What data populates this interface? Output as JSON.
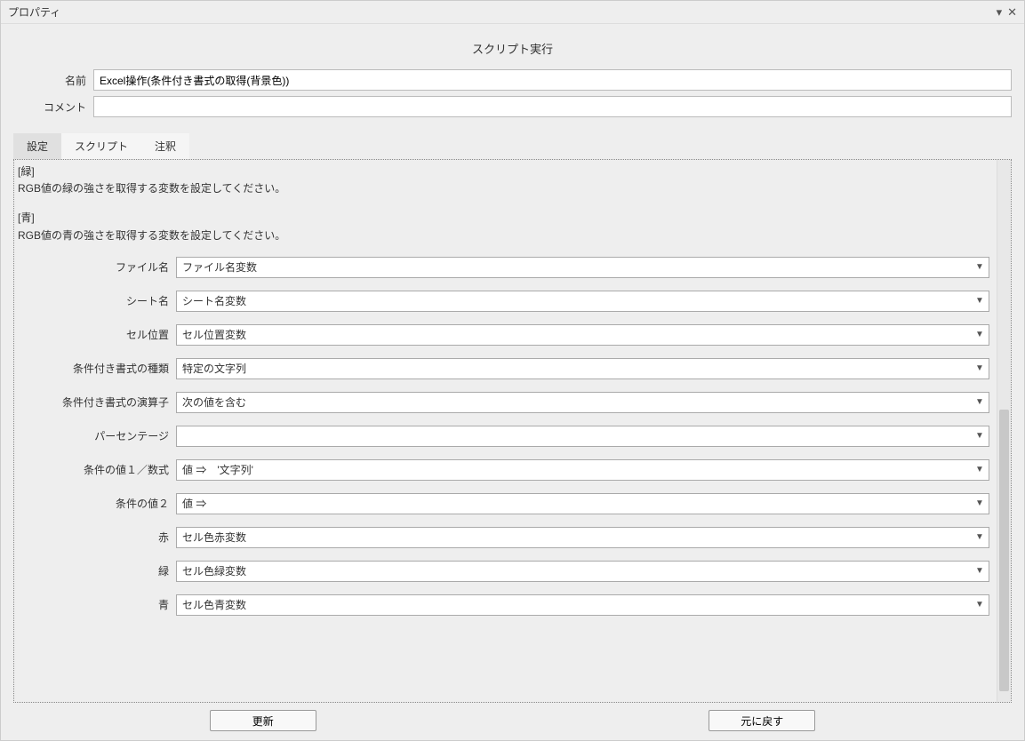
{
  "titlebar": {
    "title": "プロパティ"
  },
  "section_title": "スクリプト実行",
  "header": {
    "name_label": "名前",
    "name_value": "Excel操作(条件付き書式の取得(背景色))",
    "comment_label": "コメント",
    "comment_value": ""
  },
  "tabs": {
    "settings": "設定",
    "script": "スクリプト",
    "annotation": "注釈"
  },
  "descriptions": [
    {
      "label": "[緑]",
      "text": "RGB値の緑の強さを取得する変数を設定してください。"
    },
    {
      "label": "[青]",
      "text": "RGB値の青の強さを取得する変数を設定してください。"
    }
  ],
  "params": [
    {
      "label": "ファイル名",
      "value": "ファイル名変数"
    },
    {
      "label": "シート名",
      "value": "シート名変数"
    },
    {
      "label": "セル位置",
      "value": "セル位置変数"
    },
    {
      "label": "条件付き書式の種類",
      "value": "特定の文字列"
    },
    {
      "label": "条件付き書式の演算子",
      "value": "次の値を含む"
    },
    {
      "label": "パーセンテージ",
      "value": ""
    },
    {
      "label": "条件の値１／数式",
      "value": "値 ⇒　'文字列'"
    },
    {
      "label": "条件の値２",
      "value": "値 ⇒"
    },
    {
      "label": "赤",
      "value": "セル色赤変数"
    },
    {
      "label": "緑",
      "value": "セル色緑変数"
    },
    {
      "label": "青",
      "value": "セル色青変数"
    }
  ],
  "buttons": {
    "update": "更新",
    "revert": "元に戻す"
  }
}
